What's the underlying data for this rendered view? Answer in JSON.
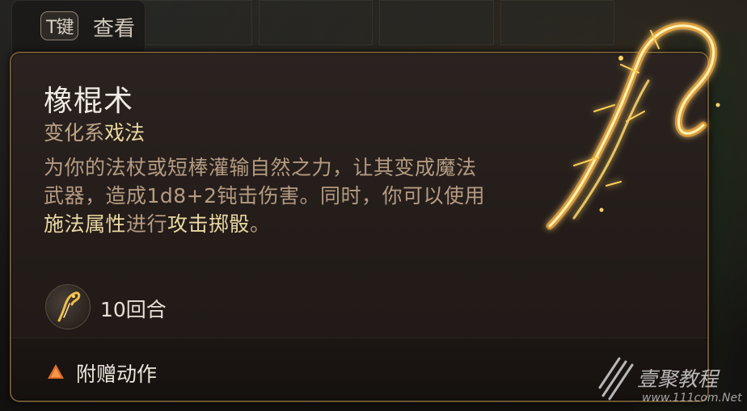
{
  "hint": {
    "key": "T键",
    "label": "查看"
  },
  "spell": {
    "name": "橡棍术",
    "school": "变化系",
    "type": "戏法",
    "description": [
      {
        "text": "为你的法杖或短棒灌输自然之力，让其变成魔法武器，造成1d8+2钝击伤害。同时，你可以使用",
        "hl": false
      },
      {
        "text": "施法属性",
        "hl": true
      },
      {
        "text": "进行",
        "hl": false
      },
      {
        "text": "攻击掷骰",
        "hl": true
      },
      {
        "text": "。",
        "hl": false
      }
    ],
    "duration": "10回合",
    "action": "附赠动作"
  },
  "icons": {
    "duration": "shillelagh-club-icon",
    "action": "orange-triangle-icon",
    "art": "glowing-club-art"
  },
  "watermark": {
    "main": "壹聚教程",
    "url": "www.111com.Net"
  },
  "colors": {
    "highlight": "#ead9a2",
    "body_text": "#b59b82",
    "title": "#f0ebe3",
    "border": "#6e5634",
    "action_triangle": "#e26a2a"
  }
}
